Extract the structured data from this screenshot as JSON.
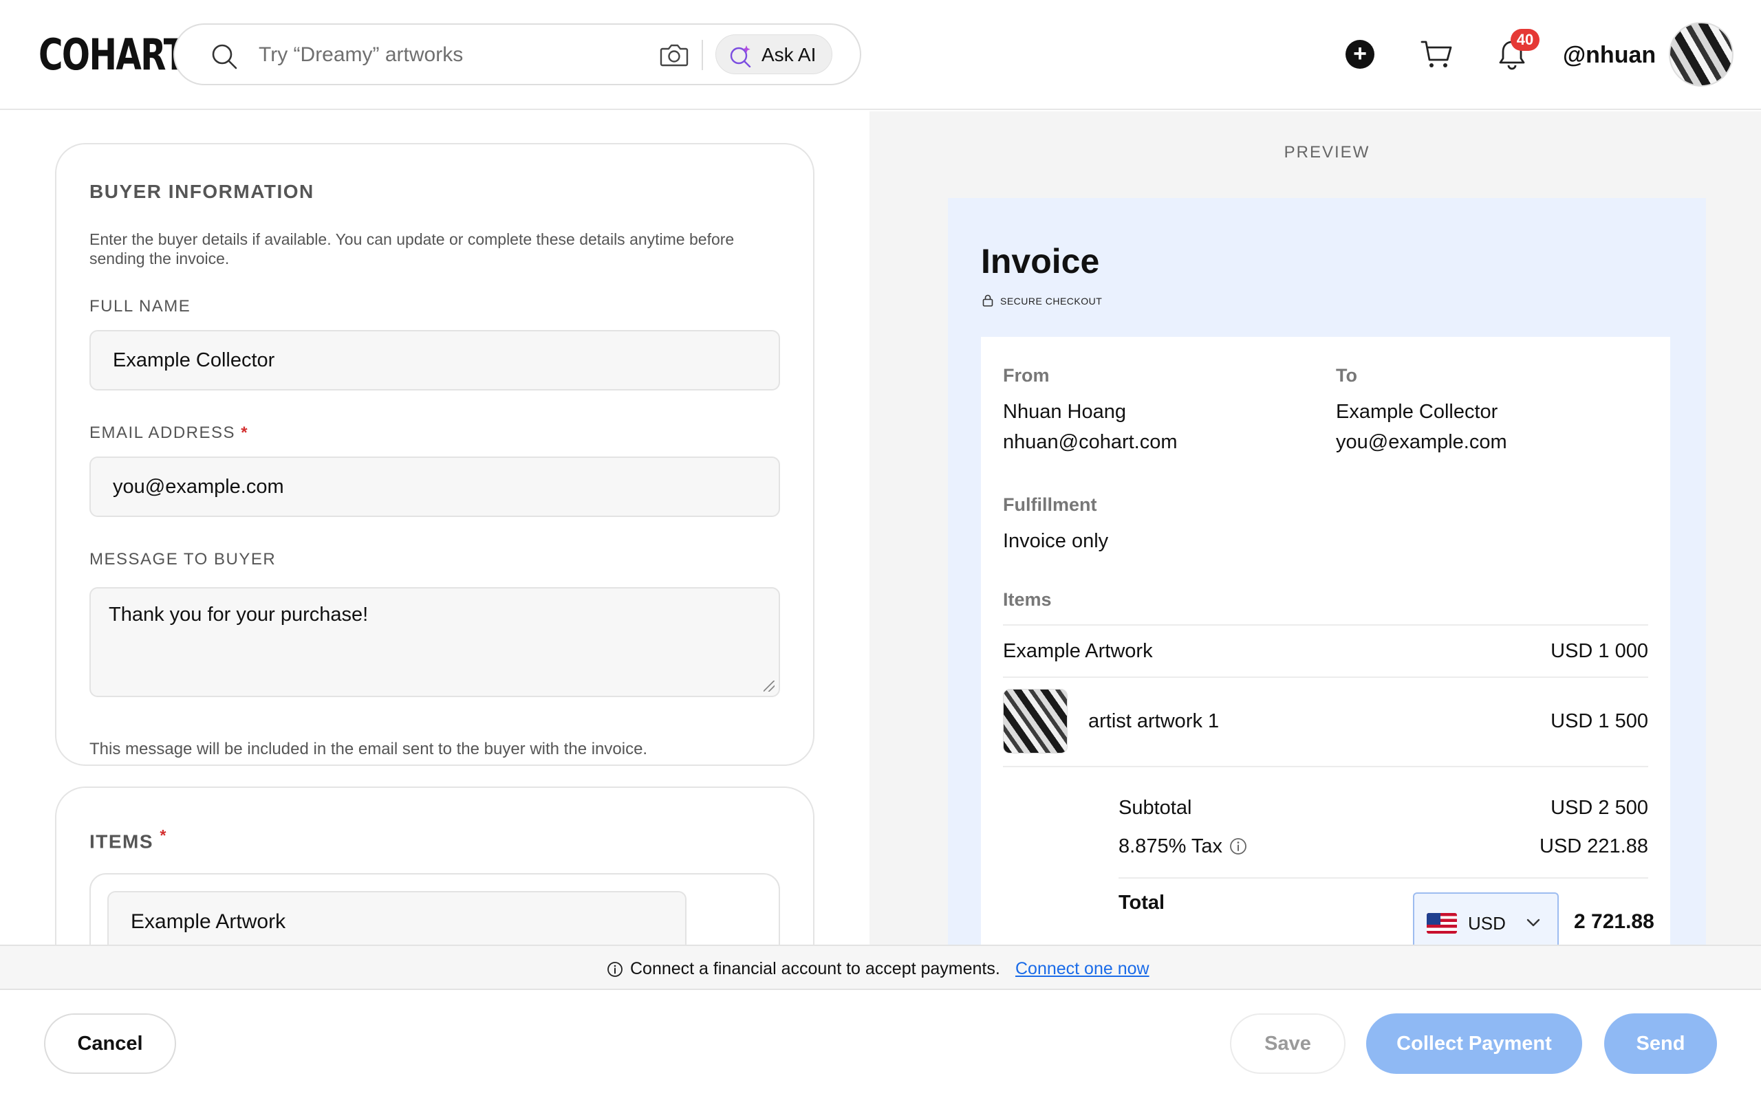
{
  "header": {
    "logo": "COHART",
    "search_placeholder": "Try “Dreamy” artworks",
    "ask_ai_label": "Ask AI",
    "notification_count": "40",
    "username": "@nhuan"
  },
  "buyer": {
    "title": "BUYER INFORMATION",
    "description": "Enter the buyer details if available. You can update or complete these details anytime before sending the invoice.",
    "full_name_label": "FULL NAME",
    "full_name_value": "Example Collector",
    "email_label": "EMAIL ADDRESS",
    "email_value": "you@example.com",
    "required_mark": "*",
    "message_label": "MESSAGE TO BUYER",
    "message_value": "Thank you for your purchase!",
    "message_help": "This message will be included in the email sent to the buyer with the invoice."
  },
  "items_section": {
    "title": "ITEMS",
    "required_mark": "*",
    "first_item_value": "Example Artwork"
  },
  "preview": {
    "label": "PREVIEW",
    "invoice_title": "Invoice",
    "secure_checkout": "SECURE CHECKOUT",
    "from_label": "From",
    "from_name": "Nhuan Hoang",
    "from_email": "nhuan@cohart.com",
    "to_label": "To",
    "to_name": "Example Collector",
    "to_email": "you@example.com",
    "fulfillment_label": "Fulfillment",
    "fulfillment_value": "Invoice only",
    "items_label": "Items",
    "items": [
      {
        "name": "Example Artwork",
        "price": "USD 1 000"
      },
      {
        "name": "artist artwork 1",
        "price": "USD 1 500"
      }
    ],
    "subtotal_label": "Subtotal",
    "subtotal_value": "USD 2 500",
    "tax_label": "8.875% Tax",
    "tax_value": "USD 221.88",
    "total_label": "Total",
    "currency": "USD",
    "total_value": "2 721.88"
  },
  "notice": {
    "text": "Connect a financial account to accept payments.",
    "link": "Connect one now"
  },
  "footer": {
    "cancel": "Cancel",
    "save": "Save",
    "collect_payment": "Collect Payment",
    "send": "Send"
  },
  "colors": {
    "accent_blue": "#8fb9f4",
    "link_blue": "#1a6be8",
    "badge_red": "#e53935",
    "invoice_bg": "#eaf1fe"
  }
}
